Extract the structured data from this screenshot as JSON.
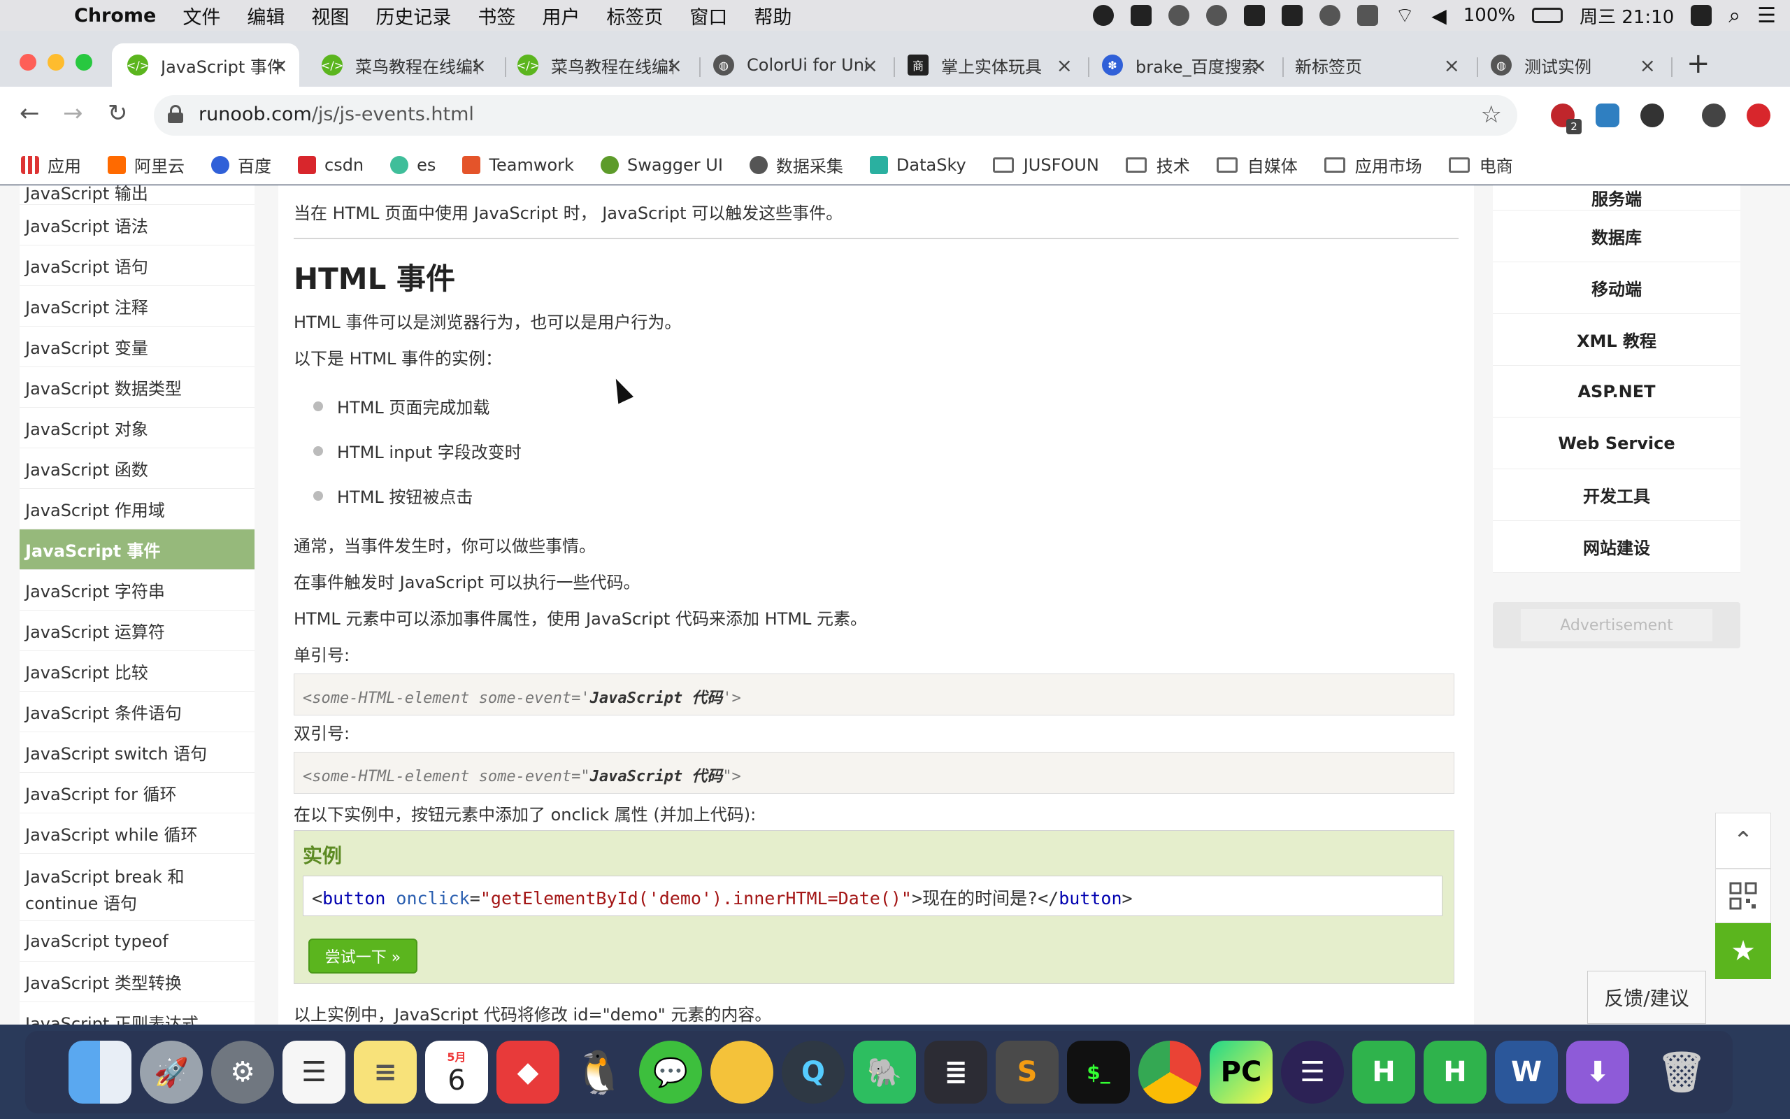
{
  "menubar": {
    "app": "Chrome",
    "items": [
      "文件",
      "编辑",
      "视图",
      "历史记录",
      "书签",
      "用户",
      "标签页",
      "窗口",
      "帮助"
    ],
    "battery": "100%",
    "clock": "周三 21:10"
  },
  "tabs": [
    {
      "title": "JavaScript 事件",
      "active": true
    },
    {
      "title": "菜鸟教程在线编辑器"
    },
    {
      "title": "菜鸟教程在线编辑器"
    },
    {
      "title": "ColorUi for UniApp"
    },
    {
      "title": "掌上实体玩具"
    },
    {
      "title": "brake_百度搜索"
    },
    {
      "title": "新标签页"
    },
    {
      "title": "测试实例"
    }
  ],
  "toolbar": {
    "url_host": "runoob.com",
    "url_path": "/js/js-events.html",
    "ext_badge": "2"
  },
  "bookmarks": [
    "应用",
    "阿里云",
    "百度",
    "csdn",
    "es",
    "Teamwork",
    "Swagger UI",
    "数据采集",
    "DataSky",
    "JUSFOUN",
    "技术",
    "自媒体",
    "应用市场",
    "电商"
  ],
  "leftnav": [
    "JavaScript 语法",
    "JavaScript 语句",
    "JavaScript 注释",
    "JavaScript 变量",
    "JavaScript 数据类型",
    "JavaScript 对象",
    "JavaScript 函数",
    "JavaScript 作用域",
    "JavaScript 事件",
    "JavaScript 字符串",
    "JavaScript 运算符",
    "JavaScript 比较",
    "JavaScript 条件语句",
    "JavaScript switch 语句",
    "JavaScript for 循环",
    "JavaScript while 循环",
    "JavaScript break 和 continue 语句",
    "JavaScript typeof",
    "JavaScript 类型转换"
  ],
  "leftnav_top_partial": "JavaScript 输出",
  "leftnav_bottom_partial": "JavaScript 正则表达式",
  "content": {
    "intro": "当在 HTML 页面中使用 JavaScript 时， JavaScript 可以触发这些事件。",
    "heading": "HTML 事件",
    "p1": "HTML 事件可以是浏览器行为，也可以是用户行为。",
    "p2": "以下是 HTML 事件的实例：",
    "list": [
      "HTML 页面完成加载",
      "HTML input 字段改变时",
      "HTML 按钮被点击"
    ],
    "p3": "通常，当事件发生时，你可以做些事情。",
    "p4": "在事件触发时 JavaScript 可以执行一些代码。",
    "p5": "HTML 元素中可以添加事件属性，使用 JavaScript 代码来添加 HTML 元素。",
    "single_label": "单引号:",
    "single_code_pre": "<some-HTML-element some-event='",
    "single_code_bold": "JavaScript 代码",
    "single_code_post": "'>",
    "double_label": "双引号:",
    "double_code_pre": "<some-HTML-element some-event=\"",
    "double_code_bold": "JavaScript 代码",
    "double_code_post": "\">",
    "p6": "在以下实例中，按钮元素中添加了 onclick 属性 (并加上代码):",
    "example_title": "实例",
    "code_lt": "<",
    "code_tag": "button",
    "code_attr": " onclick",
    "code_eq": "=",
    "code_val": "\"getElementById('demo').innerHTML=Date()\"",
    "code_text": ">现在的时间是?</",
    "code_tag_close": "button",
    "code_gt": ">",
    "try_label": "尝试一下 »",
    "p7": "以上实例中，JavaScript 代码将修改 id=\"demo\" 元素的内容。"
  },
  "rightnav": {
    "partial_top": "服务端",
    "items": [
      "数据库",
      "移动端",
      "XML 教程",
      "ASP.NET",
      "Web Service",
      "开发工具",
      "网站建设"
    ],
    "ad": "Advertisement"
  },
  "floating": {
    "up": "⌃",
    "star": "★",
    "feedback": "反馈/建议"
  },
  "dock": {
    "calendar_month": "5月",
    "calendar_day": "6",
    "apps": [
      "finder",
      "launchpad",
      "system-preferences",
      "reminders",
      "notes",
      "calendar",
      "git-client",
      "qq",
      "wechat",
      "sea-app",
      "quicktime",
      "evernote",
      "code-editor",
      "sublime-text",
      "terminal",
      "chrome",
      "pycharm",
      "eclipse",
      "hbuilder",
      "hbuilder",
      "word",
      "shield-app",
      "trash"
    ]
  }
}
